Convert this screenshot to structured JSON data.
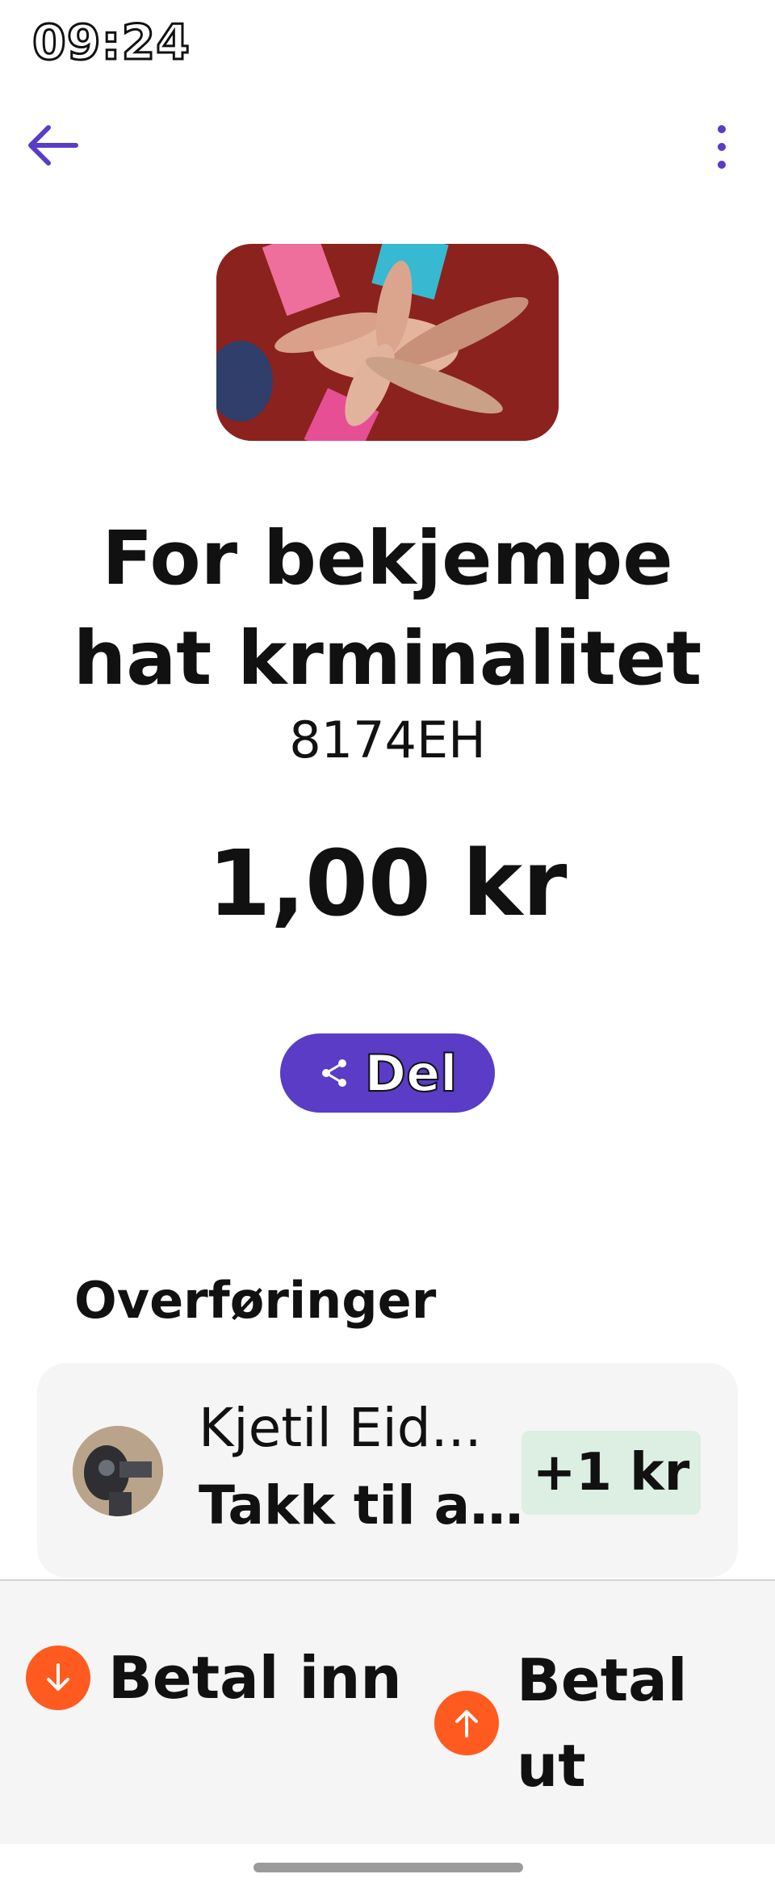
{
  "status_bar": {
    "time": "09:24"
  },
  "header": {
    "back_icon": "arrow-left-icon",
    "menu_icon": "more-vertical-icon"
  },
  "campaign": {
    "title": "For bekjempe hat krminalitet",
    "code": "8174EH",
    "amount": "1,00 kr",
    "image": "hands-together-photo"
  },
  "share_button": {
    "label": "Del",
    "icon": "share-icon"
  },
  "transfers": {
    "section_title": "Overføringer",
    "items": [
      {
        "name": "Kjetil Eid...",
        "message": "Takk til al...",
        "amount": "+1 kr"
      }
    ]
  },
  "actions": {
    "pay_in": {
      "label": "Betal inn",
      "icon": "arrow-down-icon"
    },
    "pay_out": {
      "label": "Betal ut",
      "icon": "arrow-up-icon"
    }
  },
  "colors": {
    "accent": "#5a3cc6",
    "action": "#ff5a1f",
    "positive_bg": "#ddeee3"
  }
}
